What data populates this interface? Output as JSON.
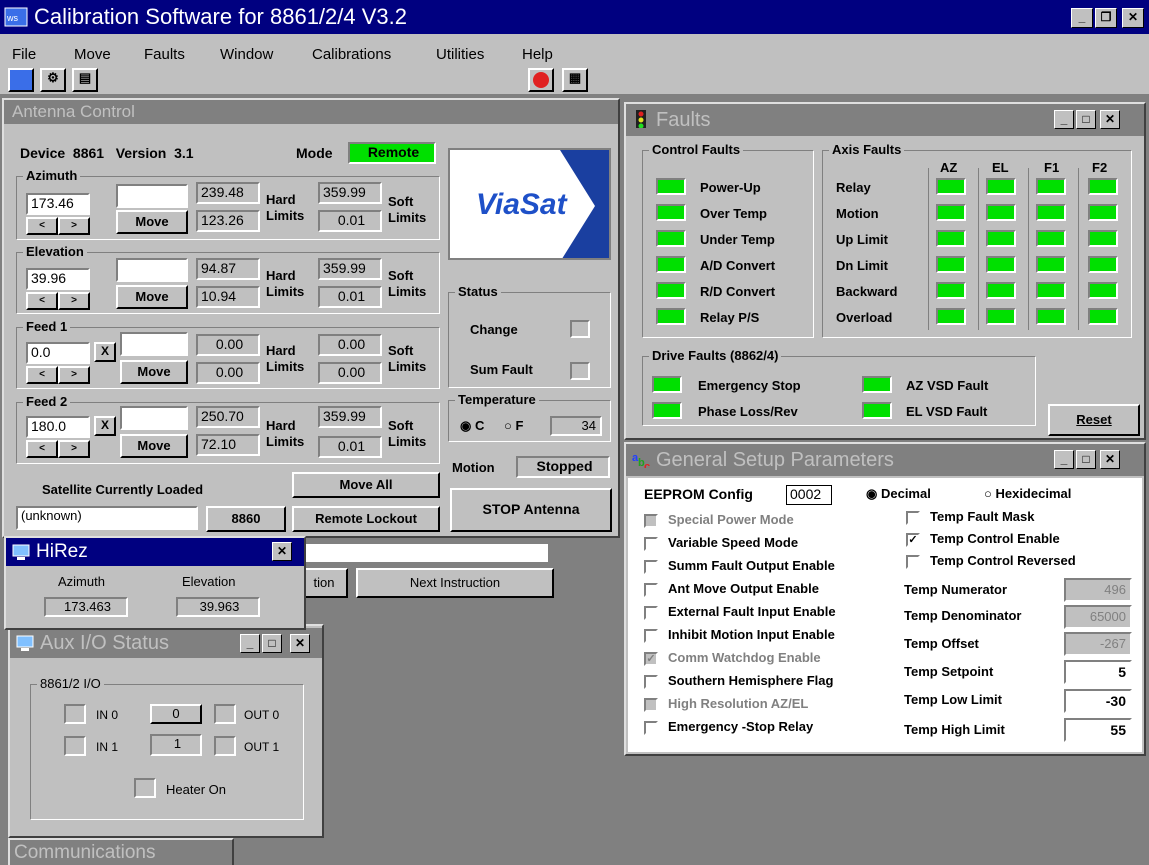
{
  "app": {
    "title": "Calibration Software for 8861/2/4  V3.2",
    "menu": [
      "File",
      "Move",
      "Faults",
      "Window",
      "Calibrations",
      "Utilities",
      "Help"
    ]
  },
  "colors": {
    "led_on": "#00e000",
    "title_active": "#000080",
    "title_inactive": "#808080",
    "desktop": "#808080"
  },
  "antenna": {
    "title": "Antenna Control",
    "device_label": "Device  8861   Version  3.1",
    "mode_label": "Mode",
    "mode_value": "Remote",
    "logo_text": "ViaSat",
    "hard_label": "Hard",
    "limits_label": "Limits",
    "soft_label": "Soft",
    "move_label": "Move",
    "axes": [
      {
        "name": "Azimuth",
        "current": "173.46",
        "hard_max": "239.48",
        "hard_min": "123.26",
        "soft_max": "359.99",
        "soft_min": "0.01"
      },
      {
        "name": "Elevation",
        "current": "39.96",
        "hard_max": "94.87",
        "hard_min": "10.94",
        "soft_max": "359.99",
        "soft_min": "0.01"
      },
      {
        "name": "Feed 1",
        "current": "0.0",
        "hard_max": "0.00",
        "hard_min": "0.00",
        "soft_max": "0.00",
        "soft_min": "0.00"
      },
      {
        "name": "Feed 2",
        "current": "180.0",
        "hard_max": "250.70",
        "hard_min": "72.10",
        "soft_max": "359.99",
        "soft_min": "0.01"
      }
    ],
    "status": {
      "title": "Status",
      "change": "Change",
      "sum_fault": "Sum Fault"
    },
    "temperature": {
      "title": "Temperature",
      "c": "C",
      "f": "F",
      "value": "34"
    },
    "motion_label": "Motion",
    "motion_value": "Stopped",
    "satellite_label": "Satellite Currently Loaded",
    "satellite_value": "(unknown)",
    "satellite_id": "8860",
    "move_all": "Move All",
    "remote_lockout": "Remote Lockout",
    "stop": "STOP Antenna",
    "next_instruction": "Next Instruction",
    "partial_btn": "tion"
  },
  "faults": {
    "title": "Faults",
    "control_title": "Control Faults",
    "control": [
      "Power-Up",
      "Over Temp",
      "Under Temp",
      "A/D Convert",
      "R/D Convert",
      "Relay P/S"
    ],
    "axis_title": "Axis Faults",
    "axis_cols": [
      "AZ",
      "EL",
      "F1",
      "F2"
    ],
    "axis_rows": [
      "Relay",
      "Motion",
      "Up Limit",
      "Dn Limit",
      "Backward",
      "Overload"
    ],
    "drive_title": "Drive Faults (8862/4)",
    "drive_left": [
      "Emergency Stop",
      "Phase Loss/Rev"
    ],
    "drive_right": [
      "AZ VSD Fault",
      "EL VSD Fault"
    ],
    "reset": "Reset"
  },
  "setup": {
    "title": "General Setup Parameters",
    "eeprom_label": "EEPROM Config",
    "eeprom_value": "0002",
    "decimal": "Decimal",
    "hex": "Hexidecimal",
    "left_checks": [
      {
        "label": "Special Power Mode",
        "checked": false,
        "disabled": true
      },
      {
        "label": "Variable Speed Mode",
        "checked": false,
        "disabled": false
      },
      {
        "label": "Summ Fault Output Enable",
        "checked": false,
        "disabled": false
      },
      {
        "label": "Ant Move Output Enable",
        "checked": false,
        "disabled": false
      },
      {
        "label": "External Fault Input Enable",
        "checked": false,
        "disabled": false
      },
      {
        "label": "Inhibit Motion Input Enable",
        "checked": false,
        "disabled": false
      },
      {
        "label": "Comm Watchdog Enable",
        "checked": true,
        "disabled": true
      },
      {
        "label": "Southern Hemisphere Flag",
        "checked": false,
        "disabled": false
      },
      {
        "label": "High Resolution AZ/EL",
        "checked": false,
        "disabled": true
      },
      {
        "label": "Emergency -Stop Relay",
        "checked": false,
        "disabled": false
      }
    ],
    "right_checks": [
      {
        "label": "Temp Fault Mask",
        "checked": false
      },
      {
        "label": "Temp Control Enable",
        "checked": true
      },
      {
        "label": "Temp Control Reversed",
        "checked": false
      }
    ],
    "params": [
      {
        "label": "Temp Numerator",
        "value": "496",
        "editable": false
      },
      {
        "label": "Temp Denominator",
        "value": "65000",
        "editable": false
      },
      {
        "label": "Temp Offset",
        "value": "-267",
        "editable": false
      },
      {
        "label": "Temp Setpoint",
        "value": "5",
        "editable": true
      },
      {
        "label": "Temp Low Limit",
        "value": "-30",
        "editable": true
      },
      {
        "label": "Temp High Limit",
        "value": "55",
        "editable": true
      }
    ]
  },
  "hirez": {
    "title": "HiRez",
    "az_label": "Azimuth",
    "el_label": "Elevation",
    "az_value": "173.463",
    "el_value": "39.963"
  },
  "aux": {
    "title": "Aux I/O Status",
    "group": "8861/2 I/O",
    "in0": "IN 0",
    "in1": "IN 1",
    "out0": "OUT 0",
    "out1": "OUT 1",
    "val0": "0",
    "val1": "1",
    "heater": "Heater On"
  },
  "comm": {
    "title": "Communications"
  }
}
